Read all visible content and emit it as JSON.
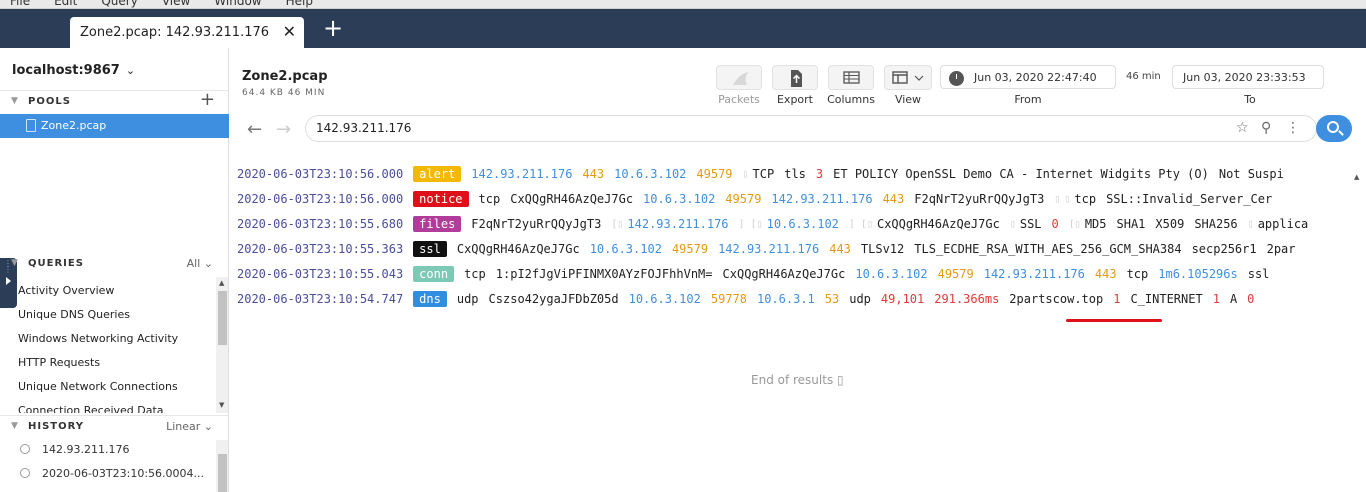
{
  "menubar": [
    "File",
    "Edit",
    "Query",
    "View",
    "Window",
    "Help"
  ],
  "tab": {
    "label": "Zone2.pcap: 142.93.211.176",
    "close": "✕",
    "new": "+"
  },
  "sidebar": {
    "host": "localhost:9867",
    "pools": {
      "title": "POOLS",
      "add": "+",
      "items": [
        "Zone2.pcap"
      ]
    },
    "queries": {
      "title": "QUERIES",
      "filter": "All",
      "items": [
        "Activity Overview",
        "Unique DNS Queries",
        "Windows Networking Activity",
        "HTTP Requests",
        "Unique Network Connections",
        "Connection Received Data"
      ]
    },
    "history": {
      "title": "HISTORY",
      "mode": "Linear",
      "items": [
        "142.93.211.176",
        "2020-06-03T23:10:56.0004..."
      ]
    }
  },
  "header": {
    "title": "Zone2.pcap",
    "subtitle": "64.4 KB  46 MIN",
    "toolbar": {
      "packets": "Packets",
      "export": "Export",
      "columns": "Columns",
      "view": "View"
    },
    "from_date": "Jun 03, 2020 22:47:40",
    "duration": "46 min",
    "to_date": "Jun 03, 2020 23:33:53",
    "from_label": "From",
    "to_label": "To"
  },
  "search": {
    "value": "142.93.211.176"
  },
  "colors": {
    "alert": "#f5b800",
    "notice": "#e0101a",
    "files": "#b23c9a",
    "ssl": "#111111",
    "conn": "#7cc9b6",
    "dns": "#2f8ee0",
    "accent": "#3f8fe0"
  },
  "results": [
    {
      "ts": "2020-06-03T23:10:56.000",
      "badge": "alert",
      "c": "#f5b800",
      "fields": [
        [
          "a",
          "142.93.211.176"
        ],
        [
          "p",
          "443"
        ],
        [
          "a",
          "10.6.3.102"
        ],
        [
          "p",
          "49579"
        ],
        [
          "s",
          "▯"
        ],
        [
          "t",
          "TCP"
        ],
        [
          "t",
          "tls"
        ],
        [
          "r",
          "3"
        ],
        [
          "t",
          "ET POLICY OpenSSL Demo CA - Internet Widgits Pty (O)"
        ],
        [
          "t",
          "Not Suspi"
        ]
      ]
    },
    {
      "ts": "2020-06-03T23:10:56.000",
      "badge": "notice",
      "c": "#e0101a",
      "fields": [
        [
          "t",
          "tcp"
        ],
        [
          "t",
          "CxQQgRH46AzQeJ7Gc"
        ],
        [
          "a",
          "10.6.3.102"
        ],
        [
          "p",
          "49579"
        ],
        [
          "a",
          "142.93.211.176"
        ],
        [
          "p",
          "443"
        ],
        [
          "t",
          "F2qNrT2yuRrQQyJgT3"
        ],
        [
          "s",
          "▯"
        ],
        [
          "s",
          "▯"
        ],
        [
          "t",
          "tcp"
        ],
        [
          "t",
          "SSL::Invalid_Server_Cer"
        ]
      ]
    },
    {
      "ts": "2020-06-03T23:10:55.680",
      "badge": "files",
      "c": "#b23c9a",
      "fields": [
        [
          "t",
          "F2qNrT2yuRrQQyJgT3"
        ],
        [
          "s",
          "[▯"
        ],
        [
          "a",
          "142.93.211.176"
        ],
        [
          "s",
          "] [▯"
        ],
        [
          "a",
          "10.6.3.102"
        ],
        [
          "s",
          "] [▯"
        ],
        [
          "t",
          "CxQQgRH46AzQeJ7Gc"
        ],
        [
          "s",
          "▯"
        ],
        [
          "t",
          "SSL"
        ],
        [
          "r",
          "0"
        ],
        [
          "s",
          "[▯"
        ],
        [
          "t",
          "MD5"
        ],
        [
          "t",
          "SHA1"
        ],
        [
          "t",
          "X509"
        ],
        [
          "t",
          "SHA256"
        ],
        [
          "s",
          "▯"
        ],
        [
          "t",
          "applica"
        ]
      ]
    },
    {
      "ts": "2020-06-03T23:10:55.363",
      "badge": "ssl",
      "c": "#111111",
      "fields": [
        [
          "t",
          "CxQQgRH46AzQeJ7Gc"
        ],
        [
          "a",
          "10.6.3.102"
        ],
        [
          "p",
          "49579"
        ],
        [
          "a",
          "142.93.211.176"
        ],
        [
          "p",
          "443"
        ],
        [
          "t",
          "TLSv12"
        ],
        [
          "t",
          "TLS_ECDHE_RSA_WITH_AES_256_GCM_SHA384"
        ],
        [
          "t",
          "secp256r1"
        ],
        [
          "t",
          "2par"
        ]
      ]
    },
    {
      "ts": "2020-06-03T23:10:55.043",
      "badge": "conn",
      "c": "#7cc9b6",
      "fields": [
        [
          "t",
          "tcp"
        ],
        [
          "t",
          "1:pI2fJgViPFINMX0AYzFOJFhhVnM="
        ],
        [
          "t",
          "CxQQgRH46AzQeJ7Gc"
        ],
        [
          "a",
          "10.6.3.102"
        ],
        [
          "p",
          "49579"
        ],
        [
          "a",
          "142.93.211.176"
        ],
        [
          "p",
          "443"
        ],
        [
          "t",
          "tcp"
        ],
        [
          "a",
          "1m6.105296s"
        ],
        [
          "t",
          "ssl"
        ]
      ]
    },
    {
      "ts": "2020-06-03T23:10:54.747",
      "badge": "dns",
      "c": "#2f8ee0",
      "fields": [
        [
          "t",
          "udp"
        ],
        [
          "t",
          "Cszso42ygaJFDbZ05d"
        ],
        [
          "a",
          "10.6.3.102"
        ],
        [
          "p",
          "59778"
        ],
        [
          "a",
          "10.6.3.1"
        ],
        [
          "p",
          "53"
        ],
        [
          "t",
          "udp"
        ],
        [
          "r",
          "49,101"
        ],
        [
          "r",
          "291.366ms"
        ],
        [
          "t",
          "2partscow.top"
        ],
        [
          "r",
          "1"
        ],
        [
          "t",
          "C_INTERNET"
        ],
        [
          "r",
          "1"
        ],
        [
          "t",
          "A"
        ],
        [
          "r",
          "0"
        ]
      ]
    }
  ],
  "end_text": "End of results ▯"
}
